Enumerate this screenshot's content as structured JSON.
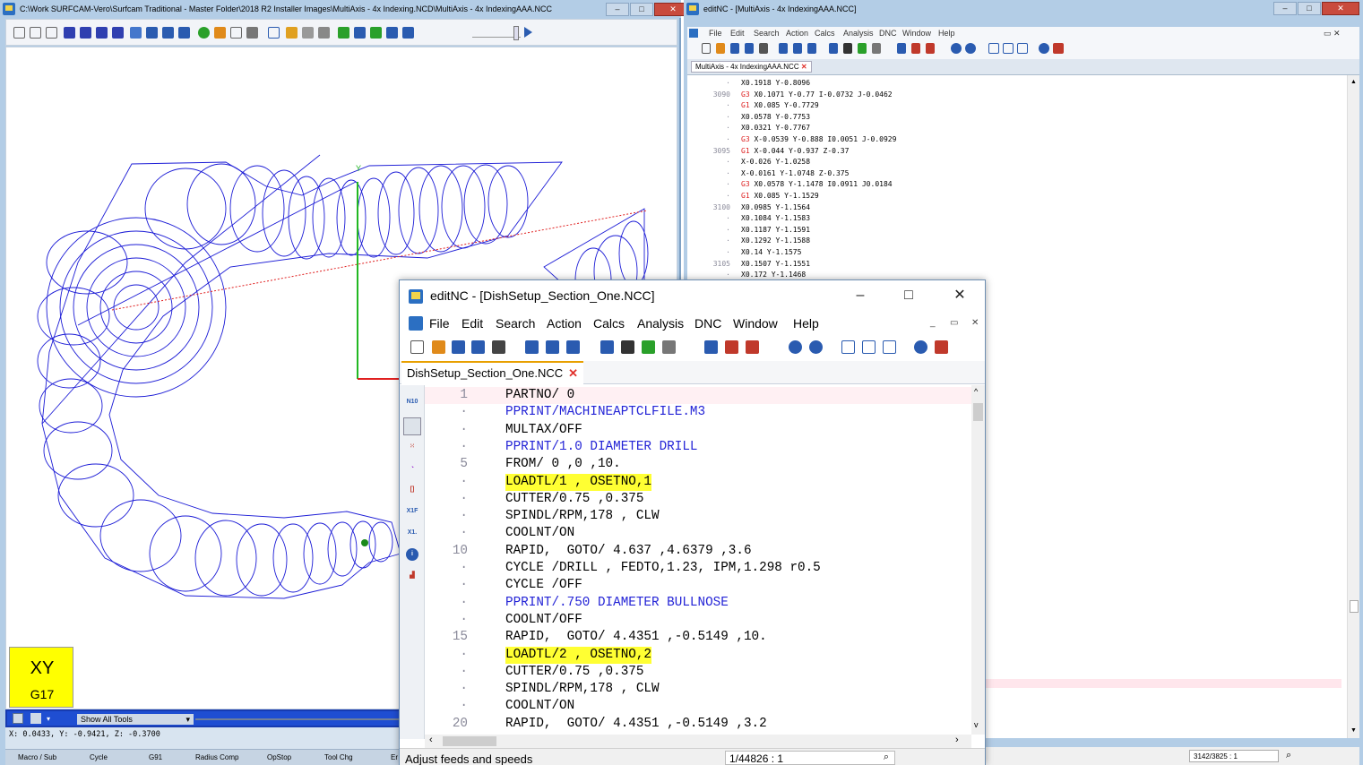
{
  "surfcam": {
    "title": "C:\\Work SURFCAM-Vero\\Surfcam Traditional - Master Folder\\2018 R2 Installer Images\\MultiAxis - 4x Indexing.NCD\\MultiAxis - 4x IndexingAAA.NCC",
    "axis_label": "Y",
    "view_name": "XY",
    "view_code": "G17",
    "tools_label": "Show All Tools",
    "coords": "X: 0.0433, Y: -0.9421, Z: -0.3700",
    "commands": [
      "Macro / Sub",
      "Cycle",
      "G91",
      "Radius Comp",
      "OpStop",
      "Tool Chg",
      "Er"
    ],
    "colors": {
      "toolpath": "#1c1cd6",
      "axis_y": "#22b822",
      "axis_x": "#e02020"
    }
  },
  "right_editor": {
    "title": "editNC - [MultiAxis - 4x IndexingAAA.NCC]",
    "menu": [
      "File",
      "Edit",
      "Search",
      "Action",
      "Calcs",
      "Analysis",
      "DNC",
      "Window",
      "Help"
    ],
    "tab": "MultiAxis - 4x IndexingAAA.NCC",
    "lines": [
      {
        "n": "·",
        "g": "",
        "code": "X0.1918 Y-0.8096"
      },
      {
        "n": "3090",
        "g": "G3",
        "code": " X0.1071 Y-0.77 I-0.0732 J-0.0462"
      },
      {
        "n": "·",
        "g": "G1",
        "code": " X0.085 Y-0.7729"
      },
      {
        "n": "·",
        "g": "",
        "code": "X0.0578 Y-0.7753"
      },
      {
        "n": "·",
        "g": "",
        "code": "X0.0321 Y-0.7767"
      },
      {
        "n": "·",
        "g": "G3",
        "code": " X-0.0539 Y-0.888 I0.0051 J-0.0929"
      },
      {
        "n": "3095",
        "g": "G1",
        "code": " X-0.044 Y-0.937 Z-0.37"
      },
      {
        "n": "·",
        "g": "",
        "code": "X-0.026 Y-1.0258"
      },
      {
        "n": "·",
        "g": "",
        "code": "X-0.0161 Y-1.0748 Z-0.375"
      },
      {
        "n": "·",
        "g": "G3",
        "code": " X0.0578 Y-1.1478 I0.0911 J0.0184"
      },
      {
        "n": "·",
        "g": "G1",
        "code": " X0.085 Y-1.1529"
      },
      {
        "n": "3100",
        "g": "",
        "code": "X0.0985 Y-1.1564"
      },
      {
        "n": "·",
        "g": "",
        "code": "X0.1084 Y-1.1583"
      },
      {
        "n": "·",
        "g": "",
        "code": "X0.1187 Y-1.1591"
      },
      {
        "n": "·",
        "g": "",
        "code": "X0.1292 Y-1.1588"
      },
      {
        "n": "·",
        "g": "",
        "code": "X0.14 Y-1.1575"
      },
      {
        "n": "3105",
        "g": "",
        "code": "X0.1507 Y-1.1551"
      },
      {
        "n": "·",
        "g": "",
        "code": "X0.172 Y-1.1468"
      }
    ],
    "position": "3142/3825 : 1"
  },
  "dialog": {
    "title": "editNC - [DishSetup_Section_One.NCC]",
    "menu": [
      "File",
      "Edit",
      "Search",
      "Action",
      "Calcs",
      "Analysis",
      "DNC",
      "Window",
      "Help"
    ],
    "tab": "DishSetup_Section_One.NCC",
    "side_icons": [
      "N10 N20",
      "bookmark",
      "grid",
      "renumber",
      "brackets",
      "X1F1 X1_F",
      "X1.0 X01.",
      "info",
      "ruler"
    ],
    "lines": [
      {
        "n": "1",
        "t": "PARTNO/ 0",
        "k": "plain"
      },
      {
        "n": "·",
        "t": "PPRINT/MACHINEAPTCLFILE.M3",
        "k": "pp"
      },
      {
        "n": "·",
        "t": "MULTAX/OFF",
        "k": "plain"
      },
      {
        "n": "·",
        "t": "PPRINT/1.0 DIAMETER DRILL",
        "k": "pp"
      },
      {
        "n": "5",
        "t": "FROM/ 0 ,0 ,10.",
        "k": "plain"
      },
      {
        "n": "·",
        "t": "LOADTL/1 , OSETNO,1",
        "k": "hl"
      },
      {
        "n": "·",
        "t": "CUTTER/0.75 ,0.375",
        "k": "plain"
      },
      {
        "n": "·",
        "t": "SPINDL/RPM,178 , CLW",
        "k": "plain"
      },
      {
        "n": "·",
        "t": "COOLNT/ON",
        "k": "plain"
      },
      {
        "n": "10",
        "t": "RAPID,  GOTO/ 4.637 ,4.6379 ,3.6",
        "k": "plain"
      },
      {
        "n": "·",
        "t": "CYCLE /DRILL , FEDTO,1.23, IPM,1.298 r0.5",
        "k": "plain"
      },
      {
        "n": "·",
        "t": "CYCLE /OFF",
        "k": "plain"
      },
      {
        "n": "·",
        "t": "PPRINT/.750 DIAMETER BULLNOSE",
        "k": "pp"
      },
      {
        "n": "·",
        "t": "COOLNT/OFF",
        "k": "plain"
      },
      {
        "n": "15",
        "t": "RAPID,  GOTO/ 4.4351 ,-0.5149 ,10.",
        "k": "plain"
      },
      {
        "n": "·",
        "t": "LOADTL/2 , OSETNO,2",
        "k": "hl"
      },
      {
        "n": "·",
        "t": "CUTTER/0.75 ,0.375",
        "k": "plain"
      },
      {
        "n": "·",
        "t": "SPINDL/RPM,178 , CLW",
        "k": "plain"
      },
      {
        "n": "·",
        "t": "COOLNT/ON",
        "k": "plain"
      },
      {
        "n": "20",
        "t": "RAPID,  GOTO/ 4.4351 ,-0.5149 ,3.2",
        "k": "plain"
      }
    ],
    "status_message": "Adjust feeds and speeds",
    "position": "1/44826 : 1"
  }
}
